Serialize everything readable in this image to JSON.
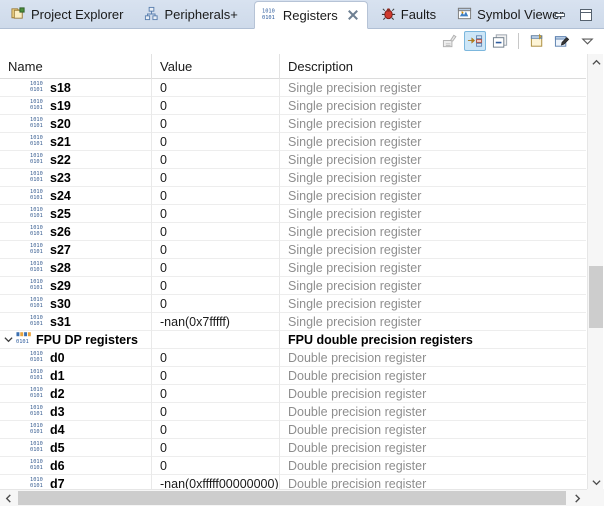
{
  "window": {
    "minimize_label": "Minimize",
    "maximize_label": "Maximize"
  },
  "tabs": [
    {
      "label": "Project Explorer",
      "icon": "project-explorer-icon",
      "active": false,
      "closable": false
    },
    {
      "label": "Peripherals+",
      "icon": "peripherals-icon",
      "active": false,
      "closable": false
    },
    {
      "label": "Registers",
      "icon": "registers-icon",
      "active": true,
      "closable": true
    },
    {
      "label": "Faults",
      "icon": "faults-icon",
      "active": false,
      "closable": false
    },
    {
      "label": "Symbol Viewer",
      "icon": "symbol-viewer-icon",
      "active": false,
      "closable": false
    }
  ],
  "toolbar": {
    "buttons": [
      {
        "name": "show-type-names-button",
        "tooltip": "Show Type Names",
        "toggled": false,
        "enabled": false
      },
      {
        "name": "show-logical-structure-button",
        "tooltip": "Show Logical Structure",
        "toggled": true,
        "enabled": true
      },
      {
        "name": "collapse-all-button",
        "tooltip": "Collapse All",
        "toggled": false,
        "enabled": true
      },
      {
        "name": "add-register-group-button",
        "tooltip": "Add Register Group",
        "toggled": false,
        "enabled": true
      },
      {
        "name": "edit-register-group-button",
        "tooltip": "Edit Register Group",
        "toggled": false,
        "enabled": true
      },
      {
        "name": "view-menu-button",
        "tooltip": "View Menu",
        "toggled": false,
        "enabled": true
      }
    ]
  },
  "table": {
    "columns": [
      {
        "key": "name",
        "label": "Name"
      },
      {
        "key": "value",
        "label": "Value"
      },
      {
        "key": "description",
        "label": "Description"
      }
    ],
    "rows": [
      {
        "type": "register",
        "name": "s18",
        "value": "0",
        "description": "Single precision register"
      },
      {
        "type": "register",
        "name": "s19",
        "value": "0",
        "description": "Single precision register"
      },
      {
        "type": "register",
        "name": "s20",
        "value": "0",
        "description": "Single precision register"
      },
      {
        "type": "register",
        "name": "s21",
        "value": "0",
        "description": "Single precision register"
      },
      {
        "type": "register",
        "name": "s22",
        "value": "0",
        "description": "Single precision register"
      },
      {
        "type": "register",
        "name": "s23",
        "value": "0",
        "description": "Single precision register"
      },
      {
        "type": "register",
        "name": "s24",
        "value": "0",
        "description": "Single precision register"
      },
      {
        "type": "register",
        "name": "s25",
        "value": "0",
        "description": "Single precision register"
      },
      {
        "type": "register",
        "name": "s26",
        "value": "0",
        "description": "Single precision register"
      },
      {
        "type": "register",
        "name": "s27",
        "value": "0",
        "description": "Single precision register"
      },
      {
        "type": "register",
        "name": "s28",
        "value": "0",
        "description": "Single precision register"
      },
      {
        "type": "register",
        "name": "s29",
        "value": "0",
        "description": "Single precision register"
      },
      {
        "type": "register",
        "name": "s30",
        "value": "0",
        "description": "Single precision register"
      },
      {
        "type": "register",
        "name": "s31",
        "value": "-nan(0x7fffff)",
        "description": "Single precision register"
      },
      {
        "type": "group",
        "name": "FPU DP registers",
        "value": "",
        "description": "FPU double precision registers",
        "expanded": true
      },
      {
        "type": "register",
        "name": "d0",
        "value": "0",
        "description": "Double precision register"
      },
      {
        "type": "register",
        "name": "d1",
        "value": "0",
        "description": "Double precision register"
      },
      {
        "type": "register",
        "name": "d2",
        "value": "0",
        "description": "Double precision register"
      },
      {
        "type": "register",
        "name": "d3",
        "value": "0",
        "description": "Double precision register"
      },
      {
        "type": "register",
        "name": "d4",
        "value": "0",
        "description": "Double precision register"
      },
      {
        "type": "register",
        "name": "d5",
        "value": "0",
        "description": "Double precision register"
      },
      {
        "type": "register",
        "name": "d6",
        "value": "0",
        "description": "Double precision register"
      },
      {
        "type": "register",
        "name": "d7",
        "value": "-nan(0xfffff00000000)",
        "description": "Double precision register"
      }
    ]
  },
  "scrollbars": {
    "vertical": {
      "thumb_top_pct": 49,
      "thumb_height_pct": 14
    },
    "horizontal": {
      "thumb_left_pct": 3,
      "thumb_width_pct": 94
    }
  },
  "colors": {
    "accent": "#cde6f7",
    "accent_border": "#7cb7dd",
    "tabbar_bg": "#d4dfee",
    "description_text": "#8e8e8e",
    "scrollbar_thumb": "#cdcdcd"
  }
}
